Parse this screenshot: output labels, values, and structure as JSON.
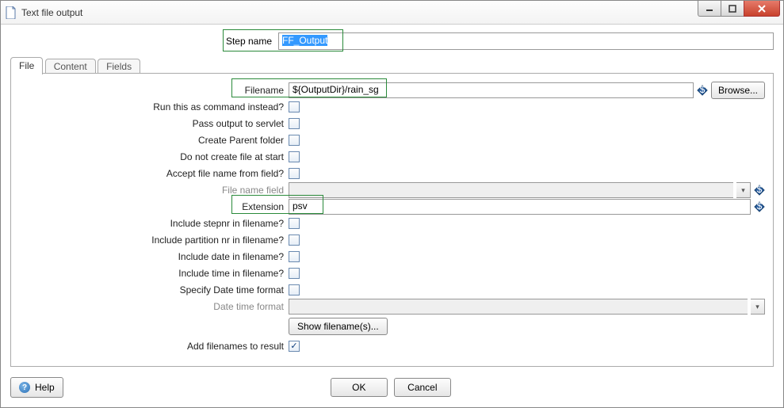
{
  "window": {
    "title": "Text file output",
    "buttons": {
      "minimize": "–",
      "maximize": "□",
      "close": "X"
    }
  },
  "step_name": {
    "label": "Step name",
    "value": "FF_Output"
  },
  "tabs": {
    "file": "File",
    "content": "Content",
    "fields": "Fields"
  },
  "file_tab": {
    "filename_label": "Filename",
    "filename_value": "${OutputDir}/rain_sg",
    "browse": "Browse...",
    "run_as_command": "Run this as command instead?",
    "pass_to_servlet": "Pass output to servlet",
    "create_parent": "Create Parent folder",
    "no_create_at_start": "Do not create file at start",
    "accept_from_field": "Accept file name from field?",
    "file_name_field": "File name field",
    "extension_label": "Extension",
    "extension_value": "psv",
    "include_stepnr": "Include stepnr in filename?",
    "include_partition": "Include partition nr in filename?",
    "include_date": "Include date in filename?",
    "include_time": "Include time in filename?",
    "specify_dt_format": "Specify Date time format",
    "dt_format": "Date time format",
    "show_filenames": "Show filename(s)...",
    "track_filenames": "Add filenames to result"
  },
  "buttons": {
    "ok": "OK",
    "cancel": "Cancel",
    "help": "Help"
  }
}
